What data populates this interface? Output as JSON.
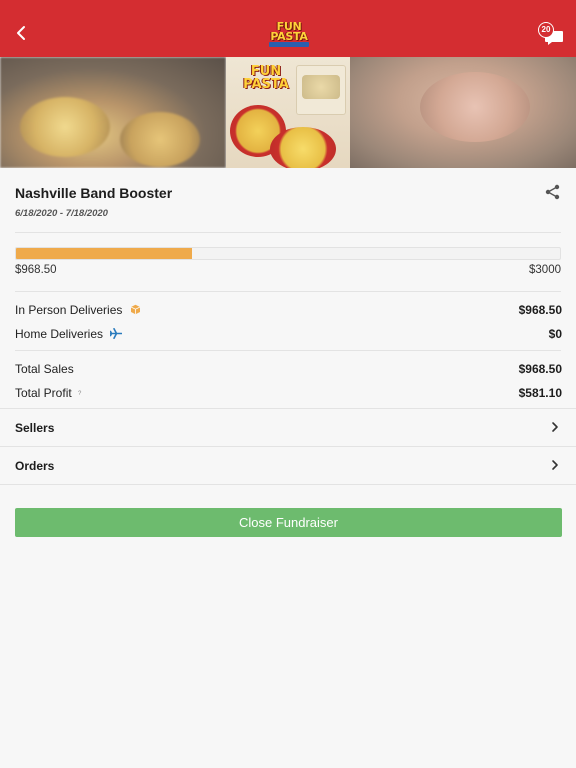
{
  "header": {
    "logo_line1": "FUN",
    "logo_line2": "PASTA",
    "notification_count": "20",
    "color": "#d42d31"
  },
  "banner": {
    "logo_line1": "FUN",
    "logo_line2": "PASTA"
  },
  "fundraiser": {
    "name": "Nashville Band Booster",
    "dates": "6/18/2020 - 7/18/2020",
    "raised": "$968.50",
    "goal": "$3000",
    "progress_fraction": 0.323,
    "progress_color": "#efaa4b"
  },
  "deliveries": {
    "in_person_label": "In Person Deliveries",
    "in_person_value": "$968.50",
    "in_person_icon": "box-icon",
    "home_label": "Home Deliveries",
    "home_value": "$0",
    "home_icon": "plane-icon"
  },
  "totals": {
    "sales_label": "Total Sales",
    "sales_value": "$968.50",
    "profit_label": "Total Profit",
    "profit_value": "$581.10",
    "profit_marker": "?"
  },
  "nav": {
    "sellers_label": "Sellers",
    "orders_label": "Orders"
  },
  "actions": {
    "close_label": "Close Fundraiser",
    "close_color": "#6dbb6e"
  }
}
